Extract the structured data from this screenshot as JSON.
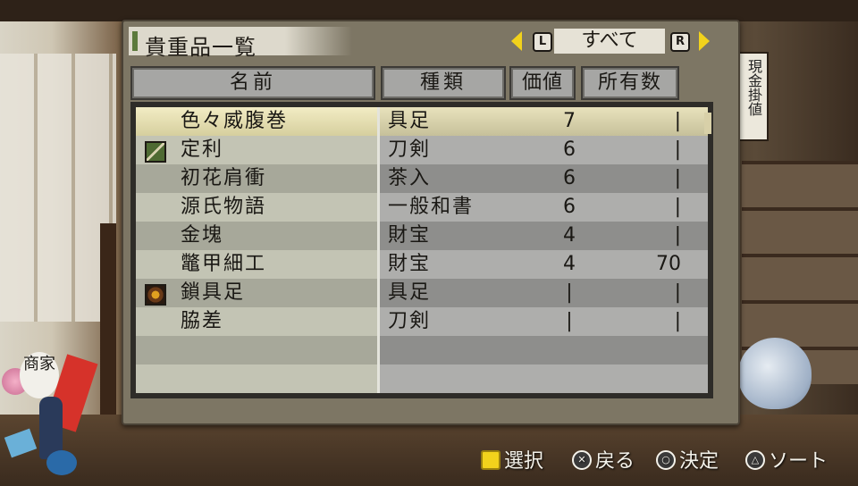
{
  "header": {
    "title": "貴重品一覧"
  },
  "filter": {
    "left_button": "L",
    "right_button": "R",
    "current": "すべて",
    "accent_color": "#f2d21c"
  },
  "columns": {
    "name": "名前",
    "type": "種類",
    "value": "価値",
    "count": "所有数"
  },
  "items": [
    {
      "name": "色々威腹巻",
      "type": "具足",
      "value": "7",
      "count": "|",
      "icon": "",
      "selected": true
    },
    {
      "name": "定利",
      "type": "刀剣",
      "value": "6",
      "count": "|",
      "icon": "sword-icon"
    },
    {
      "name": "初花肩衝",
      "type": "茶入",
      "value": "6",
      "count": "|",
      "icon": ""
    },
    {
      "name": "源氏物語",
      "type": "一般和書",
      "value": "6",
      "count": "|",
      "icon": ""
    },
    {
      "name": "金塊",
      "type": "財宝",
      "value": "4",
      "count": "|",
      "icon": ""
    },
    {
      "name": "鼈甲細工",
      "type": "財宝",
      "value": "4",
      "count": "70",
      "icon": ""
    },
    {
      "name": "鎖具足",
      "type": "具足",
      "value": "|",
      "count": "|",
      "icon": "armor-icon"
    },
    {
      "name": "脇差",
      "type": "刀剣",
      "value": "|",
      "count": "|",
      "icon": ""
    }
  ],
  "controls": {
    "select": "選択",
    "back": "戻る",
    "confirm": "決定",
    "sort": "ソート"
  },
  "scene": {
    "lantern_text": "現金掛値",
    "emblem_text": "商家"
  }
}
